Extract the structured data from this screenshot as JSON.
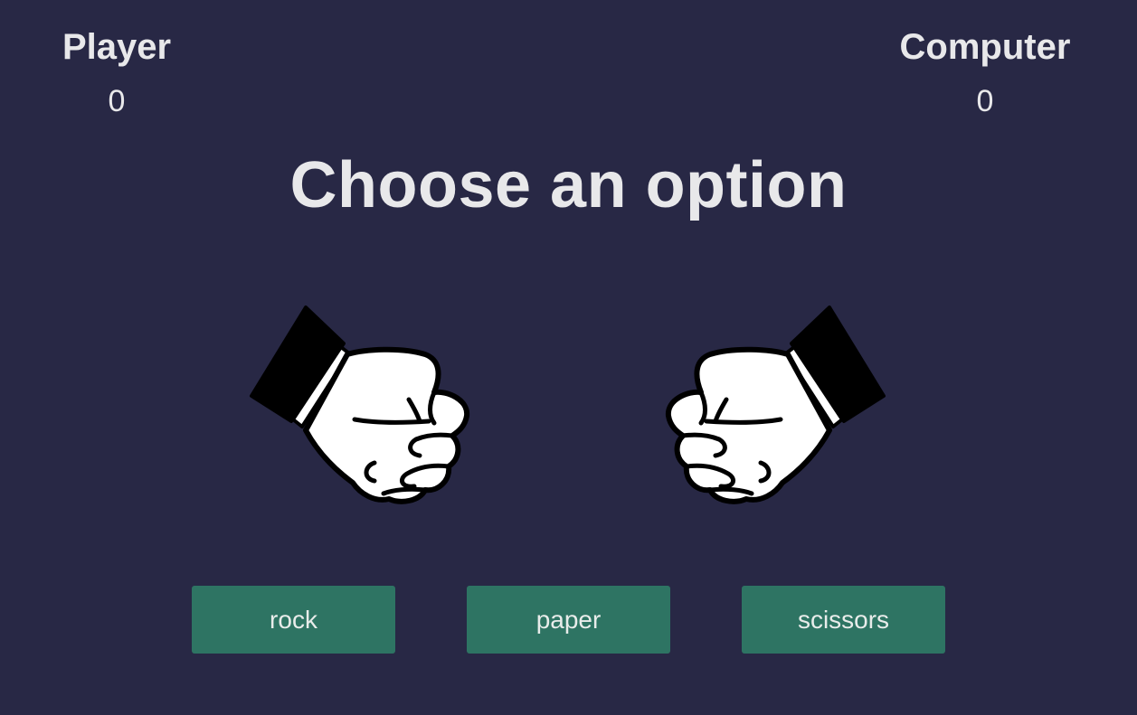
{
  "scoreboard": {
    "player": {
      "label": "Player",
      "score": "0"
    },
    "computer": {
      "label": "Computer",
      "score": "0"
    }
  },
  "title": "Choose an option",
  "hands": {
    "player": {
      "icon": "fist-icon",
      "shape": "rock"
    },
    "computer": {
      "icon": "fist-icon",
      "shape": "rock"
    }
  },
  "choices": [
    {
      "label": "rock"
    },
    {
      "label": "paper"
    },
    {
      "label": "scissors"
    }
  ],
  "colors": {
    "background": "#282845",
    "text": "#e8e8ea",
    "button": "#2e7463"
  }
}
